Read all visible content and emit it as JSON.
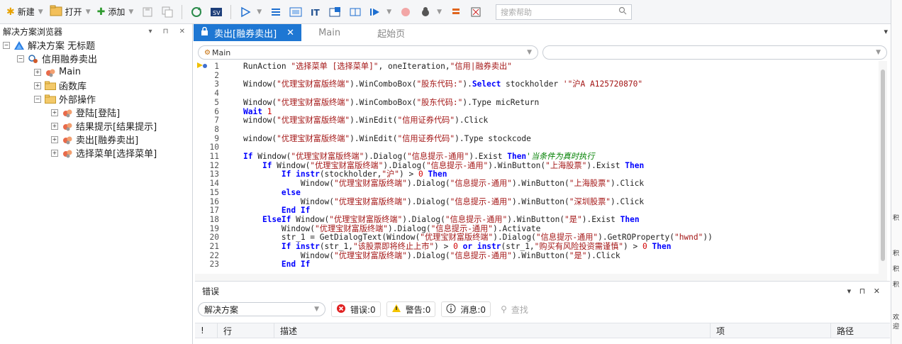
{
  "toolbar": {
    "new_label": "新建",
    "open_label": "打开",
    "add_label": "添加",
    "search_placeholder": "搜索帮助"
  },
  "explorer": {
    "title": "解决方案浏览器",
    "controls": "▾ ⊓ ✕",
    "tree": [
      {
        "label": "解决方案 无标题",
        "level": 0,
        "expander": "⊟",
        "icon": "solution-icon"
      },
      {
        "label": "信用融券卖出",
        "level": 1,
        "expander": "⊟",
        "icon": "test-icon"
      },
      {
        "label": "Main",
        "level": 2,
        "expander": "⊞",
        "icon": "action-icon"
      },
      {
        "label": "函数库",
        "level": 2,
        "expander": "⊞",
        "icon": "folder-icon"
      },
      {
        "label": "外部操作",
        "level": 2,
        "expander": "⊟",
        "icon": "folder-icon"
      },
      {
        "label": "登陆[登陆]",
        "level": 3,
        "expander": "⊞",
        "icon": "action-icon"
      },
      {
        "label": "结果提示[结果提示]",
        "level": 3,
        "expander": "⊞",
        "icon": "action-icon"
      },
      {
        "label": "卖出[融券卖出]",
        "level": 3,
        "expander": "⊞",
        "icon": "action-icon"
      },
      {
        "label": "选择菜单[选择菜单]",
        "level": 3,
        "expander": "⊞",
        "icon": "action-icon"
      }
    ]
  },
  "tabs": [
    {
      "label": "卖出[融券卖出]",
      "active": true,
      "close": "✕"
    },
    {
      "label": "Main",
      "active": false
    },
    {
      "label": "起始页",
      "active": false
    }
  ],
  "codebar": {
    "left_value": "Main",
    "right_value": ""
  },
  "code_lines": [
    {
      "n": "1",
      "html": "RunAction <span class='str'>\"选择菜单 [选择菜单]\"</span>, oneIteration,<span class='str'>\"信用|融券卖出\"</span>"
    },
    {
      "n": "2",
      "html": ""
    },
    {
      "n": "3",
      "html": "Window(<span class='str'>\"优理宝财富版终端\"</span>).WinComboBox(<span class='str'>\"股东代码:\"</span>).<span class='kw'>Select</span> stockholder <span class='str'>'\"沪A A125720870\"</span>"
    },
    {
      "n": "4",
      "html": ""
    },
    {
      "n": "5",
      "html": "Window(<span class='str'>\"优理宝财富版终端\"</span>).WinComboBox(<span class='str'>\"股东代码:\"</span>).Type micReturn"
    },
    {
      "n": "6",
      "html": "<span class='kw'>Wait</span> <span class='num'>1</span>"
    },
    {
      "n": "7",
      "html": "window(<span class='str'>\"优理宝财富版终端\"</span>).WinEdit(<span class='str'>\"信用证券代码\"</span>).Click"
    },
    {
      "n": "8",
      "html": ""
    },
    {
      "n": "9",
      "html": "window(<span class='str'>\"优理宝财富版终端\"</span>).WinEdit(<span class='str'>\"信用证券代码\"</span>).Type stockcode"
    },
    {
      "n": "10",
      "html": ""
    },
    {
      "n": "11",
      "html": "<span class='kw'>If</span> Window(<span class='str'>\"优理宝财富版终端\"</span>).Dialog(<span class='str'>\"信息提示-通用\"</span>).Exist <span class='kw'>Then</span><span class='cmt'>'当条件为真时执行</span>"
    },
    {
      "n": "12",
      "html": "    <span class='kw'>If</span> Window(<span class='str'>\"优理宝财富版终端\"</span>).Dialog(<span class='str'>\"信息提示-通用\"</span>).WinButton(<span class='str'>\"上海股票\"</span>).Exist <span class='kw'>Then</span>"
    },
    {
      "n": "13",
      "html": "        <span class='kw'>If</span> <span class='kw'>instr</span>(stockholder,<span class='str'>\"沪\"</span>) &gt; <span class='num'>0</span> <span class='kw'>Then</span>"
    },
    {
      "n": "14",
      "html": "            Window(<span class='str'>\"优理宝财富版终端\"</span>).Dialog(<span class='str'>\"信息提示-通用\"</span>).WinButton(<span class='str'>\"上海股票\"</span>).Click"
    },
    {
      "n": "15",
      "html": "        <span class='kw'>else</span>"
    },
    {
      "n": "16",
      "html": "            Window(<span class='str'>\"优理宝财富版终端\"</span>).Dialog(<span class='str'>\"信息提示-通用\"</span>).WinButton(<span class='str'>\"深圳股票\"</span>).Click"
    },
    {
      "n": "17",
      "html": "        <span class='kw'>End</span> <span class='kw'>If</span>"
    },
    {
      "n": "18",
      "html": "    <span class='kw'>ElseIf</span> Window(<span class='str'>\"优理宝财富版终端\"</span>).Dialog(<span class='str'>\"信息提示-通用\"</span>).WinButton(<span class='str'>\"是\"</span>).Exist <span class='kw'>Then</span>"
    },
    {
      "n": "19",
      "html": "        Window(<span class='str'>\"优理宝财富版终端\"</span>).Dialog(<span class='str'>\"信息提示-通用\"</span>).Activate"
    },
    {
      "n": "20",
      "html": "        str_1 = GetDialogText(Window(<span class='str'>\"优理宝财富版终端\"</span>).Dialog(<span class='str'>\"信息提示-通用\"</span>).GetROProperty(<span class='str'>\"hwnd\"</span>))"
    },
    {
      "n": "21",
      "html": "        <span class='kw'>If</span> <span class='kw'>instr</span>(str_1,<span class='str'>\"该股票即将终止上市\"</span>) &gt; <span class='num'>0</span> <span class='kw'>or</span> <span class='kw'>instr</span>(str_1,<span class='str'>\"购买有风险投资需谨慎\"</span>) &gt; <span class='num'>0</span> <span class='kw'>Then</span>"
    },
    {
      "n": "22",
      "html": "            Window(<span class='str'>\"优理宝财富版终端\"</span>).Dialog(<span class='str'>\"信息提示-通用\"</span>).WinButton(<span class='str'>\"是\"</span>).Click"
    },
    {
      "n": "23",
      "html": "        <span class='kw'>End</span> <span class='kw'>If</span>"
    }
  ],
  "error_panel": {
    "title": "错误",
    "controls": "▾ ⊓ ✕",
    "scope": "解决方案",
    "errors_label": "错误:0",
    "warnings_label": "警告:0",
    "messages_label": "消息:0",
    "find_label": "查找",
    "columns": [
      "!",
      "行",
      "描述",
      "项",
      "路径"
    ]
  },
  "right_strip": [
    "积",
    "积",
    "积",
    "积",
    "欢迎"
  ]
}
